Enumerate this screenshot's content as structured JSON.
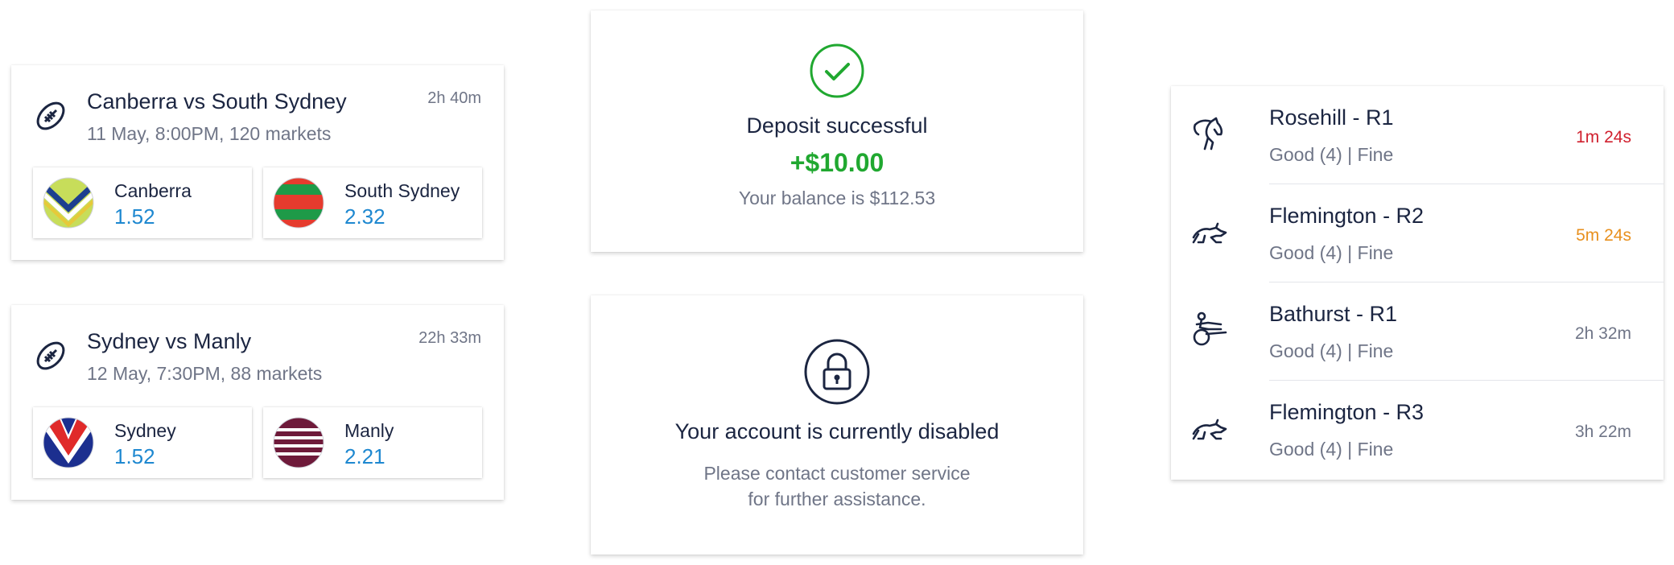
{
  "matches": [
    {
      "title": "Canberra vs South Sydney",
      "meta": "11 May, 8:00PM, 120 markets",
      "time": "2h 40m",
      "sport_icon": "rugby-ball-icon",
      "home": {
        "name": "Canberra",
        "odds": "1.52",
        "logo": "canberra-logo"
      },
      "away": {
        "name": "South Sydney",
        "odds": "2.32",
        "logo": "south-sydney-logo"
      }
    },
    {
      "title": "Sydney vs Manly",
      "meta": "12 May, 7:30PM, 88 markets",
      "time": "22h 33m",
      "sport_icon": "rugby-ball-icon",
      "home": {
        "name": "Sydney",
        "odds": "1.52",
        "logo": "sydney-logo"
      },
      "away": {
        "name": "Manly",
        "odds": "2.21",
        "logo": "manly-logo"
      }
    }
  ],
  "deposit": {
    "icon": "check-circle-icon",
    "title": "Deposit successful",
    "amount": "+$10.00",
    "balance": "Your balance is $112.53",
    "amount_color": "#20a830"
  },
  "account_disabled": {
    "icon": "lock-icon",
    "title": "Your account is currently disabled",
    "message_line1": "Please contact customer service",
    "message_line2": "for further assistance."
  },
  "races": [
    {
      "name": "Rosehill - R1",
      "condition": "Good (4) | Fine",
      "time": "1m 24s",
      "time_color": "#d0202e",
      "icon": "horse-icon"
    },
    {
      "name": "Flemington - R2",
      "condition": "Good (4) | Fine",
      "time": "5m 24s",
      "time_color": "#e8901e",
      "icon": "greyhound-icon"
    },
    {
      "name": "Bathurst - R1",
      "condition": "Good (4) | Fine",
      "time": "2h 32m",
      "time_color": "#6f7587",
      "icon": "harness-racing-icon"
    },
    {
      "name": "Flemington - R3",
      "condition": "Good (4) | Fine",
      "time": "3h 22m",
      "time_color": "#6f7587",
      "icon": "greyhound-icon"
    }
  ]
}
